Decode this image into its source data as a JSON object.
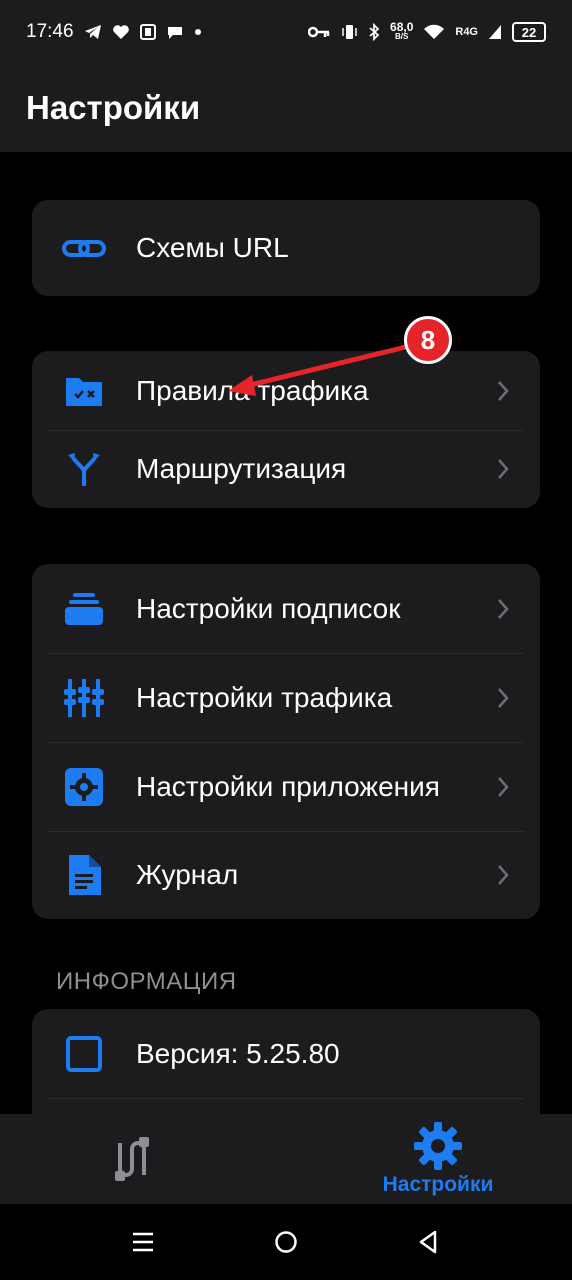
{
  "status_bar": {
    "time": "17:46",
    "net_speed_value": "68,0",
    "net_speed_unit": "B/S",
    "network_type": "R4G",
    "battery": "22",
    "left_icons": [
      "telegram-icon",
      "heart-icon",
      "nfc-icon",
      "chat-icon",
      "dot-icon"
    ],
    "right_icons": [
      "key-icon",
      "vibrate-icon",
      "bluetooth-icon",
      "wifi-icon",
      "signal-icon",
      "battery-icon"
    ]
  },
  "header": {
    "title": "Настройки"
  },
  "groups": {
    "url": {
      "label": "Схемы URL",
      "icon": "link-icon"
    },
    "rules": [
      {
        "label": "Правила трафика",
        "icon": "folder-rules-icon"
      },
      {
        "label": "Маршрутизация",
        "icon": "routing-icon"
      }
    ],
    "settings": [
      {
        "label": "Настройки подписок",
        "icon": "subscriptions-icon"
      },
      {
        "label": "Настройки трафика",
        "icon": "equalizer-icon"
      },
      {
        "label": "Настройки приложения",
        "icon": "gear-icon"
      },
      {
        "label": "Журнал",
        "icon": "document-icon"
      }
    ]
  },
  "info": {
    "section_title": "ИНФОРМАЦИЯ",
    "version_label": "Версия: 5.25.80",
    "version_icon": "square-icon"
  },
  "tab_bar": {
    "tabs": [
      {
        "icon": "connection-icon",
        "label": "",
        "active": false
      },
      {
        "icon": "gear-icon",
        "label": "Настройки",
        "active": true
      }
    ]
  },
  "annotation": {
    "badge_number": "8"
  },
  "colors": {
    "accent": "#1d7cf2",
    "card": "#1c1c1e",
    "background": "#000000",
    "annotation": "#e5252a"
  }
}
